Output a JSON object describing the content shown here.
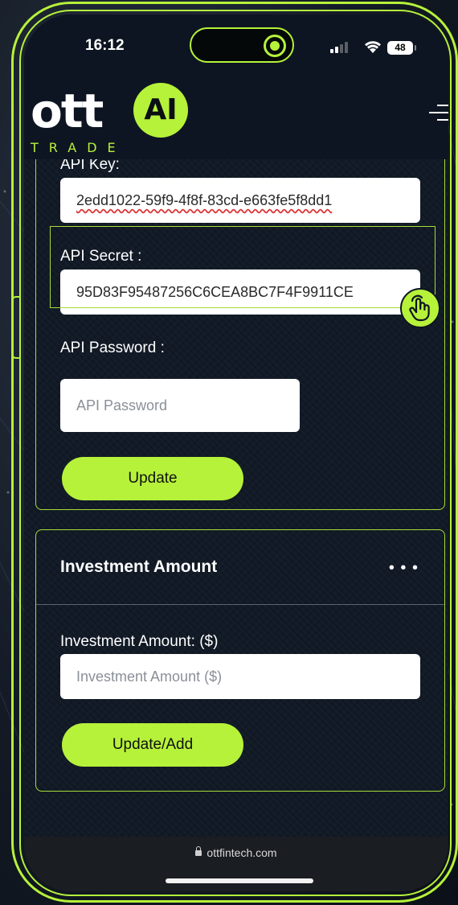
{
  "status_bar": {
    "time": "16:12",
    "battery": "48",
    "icons": [
      "signal-icon",
      "wifi-icon",
      "battery-icon"
    ]
  },
  "header": {
    "logo_text": "ott",
    "logo_badge": "AI",
    "logo_tagline": "TRADE",
    "menu_icon": "hamburger-menu-icon"
  },
  "api_card": {
    "api_key_label": "API Key:",
    "api_key_value": "2edd1022-59f9-4f8f-83cd-e663fe5f8dd1",
    "api_secret_label": "API Secret :",
    "api_secret_value": "95D83F95487256C6CEA8BC7F4F9911CE",
    "api_password_label": "API Password :",
    "api_password_placeholder": "API Password",
    "update_button": "Update"
  },
  "investment_card": {
    "title": "Investment Amount",
    "more_icon": "more-dots-icon",
    "amount_label": "Investment Amount: ($)",
    "amount_placeholder": "Investment Amount ($)",
    "update_add_button": "Update/Add"
  },
  "browser": {
    "url": "ottfintech.com"
  },
  "colors": {
    "accent": "#b6f23a",
    "background": "#111a26",
    "card_border": "#a7dc38"
  }
}
